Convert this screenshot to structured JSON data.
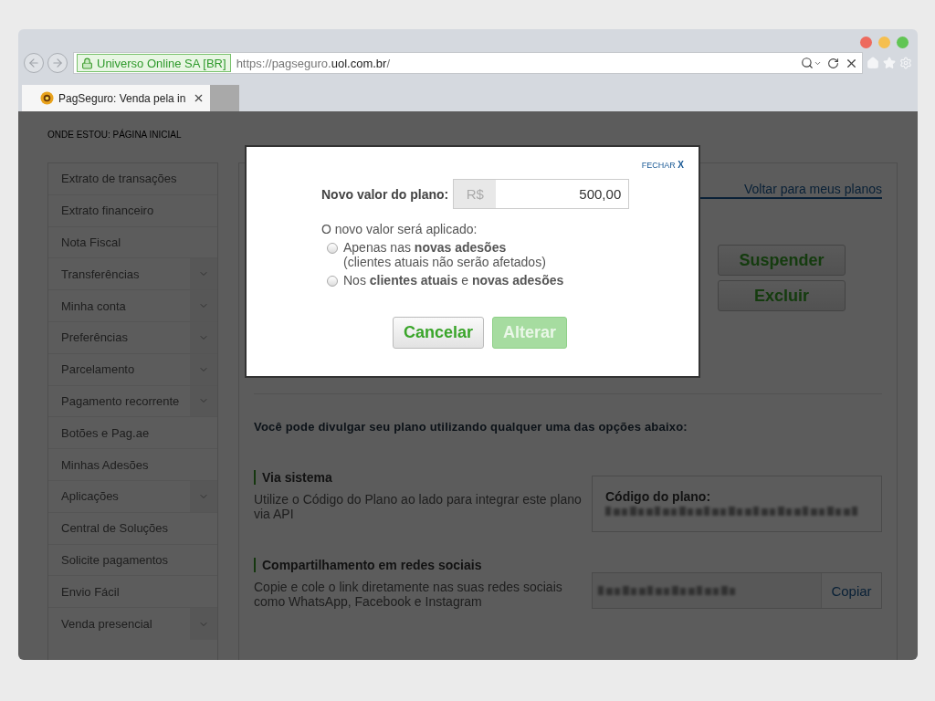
{
  "browser": {
    "window_dots": [
      {
        "color": "#ed6a5e"
      },
      {
        "color": "#f5bf4f"
      },
      {
        "color": "#61c554"
      }
    ],
    "identity": "Universo Online SA [BR]",
    "url": [
      {
        "text": "https://pagseguro.",
        "kind": "dim"
      },
      {
        "text": "uol.com.br",
        "kind": "main"
      },
      {
        "text": "/",
        "kind": "dim"
      }
    ],
    "tabs": [
      {
        "title": "PagSeguro: Venda pela in",
        "selected": true
      }
    ]
  },
  "page": {
    "breadcrumb": "ONDE ESTOU: PÁGINA INICIAL",
    "sidebar": {
      "items": [
        {
          "label": "Extrato de transações",
          "has_submenu": false
        },
        {
          "label": "Extrato financeiro",
          "has_submenu": false
        },
        {
          "label": "Nota Fiscal",
          "has_submenu": false
        },
        {
          "label": "Transferências",
          "has_submenu": true
        },
        {
          "label": "Minha conta",
          "has_submenu": true
        },
        {
          "label": "Preferências",
          "has_submenu": true
        },
        {
          "label": "Parcelamento",
          "has_submenu": true
        },
        {
          "label": "Pagamento recorrente",
          "has_submenu": true
        },
        {
          "label": "Botões e Pag.ae",
          "has_submenu": false
        },
        {
          "label": "Minhas Adesões",
          "has_submenu": false
        },
        {
          "label": "Aplicações",
          "has_submenu": true
        },
        {
          "label": "Central de Soluções",
          "has_submenu": false
        },
        {
          "label": "Solicite pagamentos",
          "has_submenu": false
        },
        {
          "label": "Envio Fácil",
          "has_submenu": false
        },
        {
          "label": "Venda presencial",
          "has_submenu": true
        }
      ]
    },
    "main": {
      "back_link": "Voltar para meus planos",
      "actions": [
        "Suspender",
        "Excluir"
      ],
      "share_intro": "Você pode divulgar seu plano utilizando qualquer uma das opções abaixo:",
      "sections": [
        {
          "kind": "code",
          "title": "Via sistema",
          "description": "Utilize o Código do Plano ao lado para integrar este plano via API",
          "box_label": "Código do plano:"
        },
        {
          "kind": "link",
          "title": "Compartilhamento em redes sociais",
          "description": "Copie e cole o link diretamente nas suas redes sociais como WhatsApp, Facebook e Instagram",
          "button": "Copiar"
        }
      ]
    }
  },
  "modal": {
    "close": "FECHAR",
    "close_mark": "X",
    "value_label": "Novo valor do plano:",
    "currency": "R$",
    "value": "500,00",
    "apply_label": "O novo valor será aplicado:",
    "options": [
      {
        "text": "Apenas nas **novas adesões**",
        "note": "(clientes atuais não serão afetados)",
        "selected": false
      },
      {
        "text": "Nos **clientes atuais** e **novas adesões**",
        "selected": false
      }
    ],
    "buttons": [
      {
        "label": "Cancelar",
        "disabled": false
      },
      {
        "label": "Alterar",
        "disabled": true
      }
    ]
  }
}
